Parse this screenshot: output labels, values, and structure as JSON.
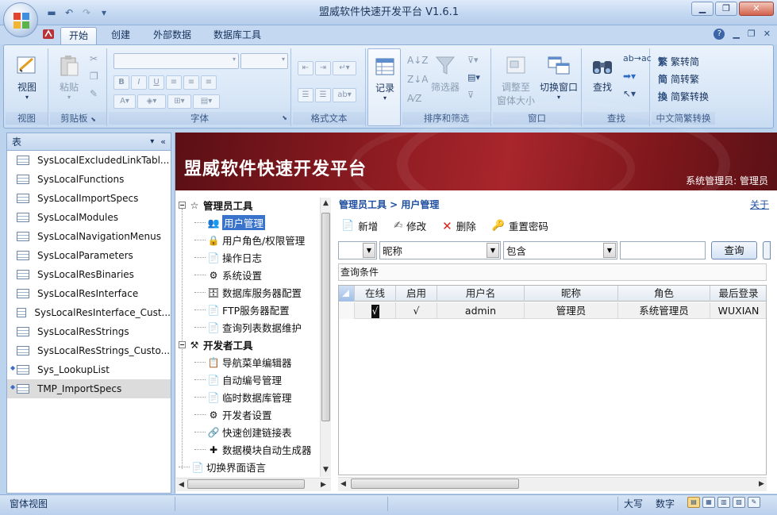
{
  "app": {
    "title": "盟威软件快速开发平台 V1.6.1"
  },
  "quick_access": {
    "icons": [
      "save-icon",
      "undo-icon",
      "redo-icon",
      "customize-icon"
    ]
  },
  "window_controls": {
    "minimize": "▁",
    "restore": "❐",
    "close": "✕"
  },
  "ribbon_tabs": [
    "开始",
    "创建",
    "外部数据",
    "数据库工具"
  ],
  "ribbon_tab_active": "开始",
  "ribbon_right_icons": [
    "help-icon",
    "minimize-icon",
    "restore-icon",
    "close-icon"
  ],
  "ribbon": {
    "view": {
      "btn": "视图",
      "label": "视图"
    },
    "clipboard": {
      "paste": "粘贴",
      "label": "剪贴板"
    },
    "font": {
      "label": "字体"
    },
    "richtext": {
      "label": "格式文本"
    },
    "records": {
      "btn": "记录"
    },
    "sort": {
      "filter": "筛选器",
      "label": "排序和筛选"
    },
    "window": {
      "fit_line1": "调整至",
      "fit_line2": "窗体大小",
      "switch": "切换窗口",
      "label": "窗口"
    },
    "find": {
      "btn": "查找",
      "label": "查找"
    },
    "chinese": {
      "t2s": "繁转简",
      "s2t": "简转繁",
      "convert": "简繁转换",
      "label": "中文简繁转换"
    }
  },
  "nav_pane": {
    "header": "表",
    "items": [
      {
        "label": "SysLocalExcludedLinkTabl...",
        "marked": false,
        "selected": false
      },
      {
        "label": "SysLocalFunctions",
        "marked": false,
        "selected": false
      },
      {
        "label": "SysLocalImportSpecs",
        "marked": false,
        "selected": false
      },
      {
        "label": "SysLocalModules",
        "marked": false,
        "selected": false
      },
      {
        "label": "SysLocalNavigationMenus",
        "marked": false,
        "selected": false
      },
      {
        "label": "SysLocalParameters",
        "marked": false,
        "selected": false
      },
      {
        "label": "SysLocalResBinaries",
        "marked": false,
        "selected": false
      },
      {
        "label": "SysLocalResInterface",
        "marked": false,
        "selected": false
      },
      {
        "label": "SysLocalResInterface_Cust...",
        "marked": false,
        "selected": false
      },
      {
        "label": "SysLocalResStrings",
        "marked": false,
        "selected": false
      },
      {
        "label": "SysLocalResStrings_Custo...",
        "marked": false,
        "selected": false
      },
      {
        "label": "Sys_LookupList",
        "marked": true,
        "selected": false
      },
      {
        "label": "TMP_ImportSpecs",
        "marked": true,
        "selected": true
      }
    ]
  },
  "banner": {
    "title": "盟威软件快速开发平台",
    "user": "系统管理员: 管理员"
  },
  "tree": {
    "admin_root": "管理员工具",
    "admin_items": [
      "用户管理",
      "用户角色/权限管理",
      "操作日志",
      "系统设置",
      "数据库服务器配置",
      "FTP服务器配置",
      "查询列表数据维护"
    ],
    "dev_root": "开发者工具",
    "dev_items": [
      "导航菜单编辑器",
      "自动编号管理",
      "临时数据库管理",
      "开发者设置",
      "快速创建链接表",
      "数据模块自动生成器"
    ],
    "lang": "切换界面语言",
    "selected": "用户管理"
  },
  "content": {
    "breadcrumb": "管理员工具 > 用户管理",
    "close_link": "关于",
    "toolbar": {
      "new": "新增",
      "edit": "修改",
      "delete": "删除",
      "reset": "重置密码"
    },
    "filter": {
      "field1": "",
      "field2": "昵称",
      "op": "包含",
      "value": "",
      "query_btn": "查询"
    },
    "query_label": "查询条件",
    "grid": {
      "columns": [
        "在线",
        "启用",
        "用户名",
        "昵称",
        "角色",
        "最后登录"
      ],
      "rows": [
        [
          "√",
          "√",
          "admin",
          "管理员",
          "系统管理员",
          "WUXIAN"
        ]
      ]
    }
  },
  "statusbar": {
    "left": "窗体视图",
    "caps": "大写",
    "num": "数字",
    "view_icons": [
      "form-view-icon",
      "datasheet-view-icon",
      "pivot-table-icon",
      "pivot-chart-icon",
      "design-view-icon"
    ]
  }
}
